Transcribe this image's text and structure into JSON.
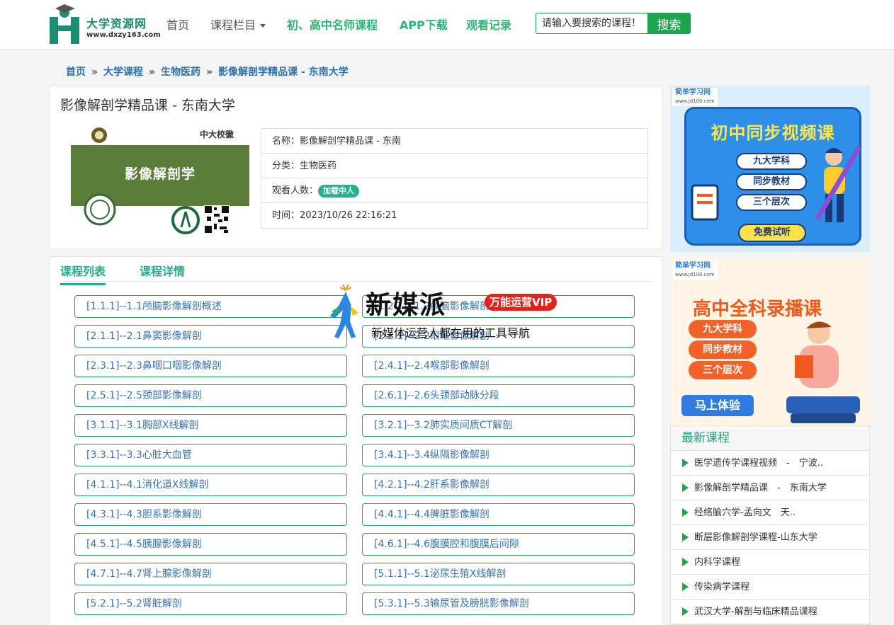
{
  "header": {
    "logo_title": "大学资源网",
    "logo_url": "www.dxzy163.com",
    "nav": {
      "home": "首页",
      "columns": "课程栏目",
      "teachers": "初、高中名师课程",
      "app": "APP下载",
      "history": "观看记录"
    },
    "search_placeholder": "请输入要搜索的课程！",
    "search_button": "搜索"
  },
  "breadcrumb": [
    "首页",
    "大学课程",
    "生物医药",
    "影像解剖学精品课 - 东南大学"
  ],
  "breadcrumb_sep": "»",
  "course": {
    "title": "影像解剖学精品课 - 东南大学",
    "cover_text": "影像解剖学",
    "cover_signature": "中大校徽",
    "name_row": "名称：影像解剖学精品课 - 东南",
    "category_row": "分类：生物医药",
    "viewers_label": "观看人数：",
    "viewers_badge": "加载中人",
    "time_row": "时间：2023/10/26 22:16:21"
  },
  "tabs": [
    "课程列表",
    "课程详情"
  ],
  "lessons": [
    "[1.1.1]--1.1颅脑影像解剖概述",
    "[1.2.1]--1.2颅脑影像解剖",
    "[2.1.1]--2.1鼻窦影像解剖",
    "[2.2.1]--2.2眼眶影像解剖",
    "[2.3.1]--2.3鼻咽口咽影像解剖",
    "[2.4.1]--2.4喉部影像解剖",
    "[2.5.1]--2.5颈部影像解剖",
    "[2.6.1]--2.6头颈部动脉分段",
    "[3.1.1]--3.1胸部X线解剖",
    "[3.2.1]--3.2肺实质间质CT解剖",
    "[3.3.1]--3.3心脏大血管",
    "[3.4.1]--3.4纵隔影像解剖",
    "[4.1.1]--4.1消化道X线解剖",
    "[4.2.1]--4.2肝系影像解剖",
    "[4.3.1]--4.3胆系影像解剖",
    "[4.4.1]--4.4脾脏影像解剖",
    "[4.5.1]--4.5胰腺影像解剖",
    "[4.6.1]--4.6腹膜腔和腹膜后间隙",
    "[4.7.1]--4.7肾上腺影像解剖",
    "[5.1.1]--5.1泌尿生殖X线解剖",
    "[5.2.1]--5.2肾脏解剖",
    "[5.3.1]--5.3输尿管及膀胱影像解剖"
  ],
  "ads": {
    "ad1": {
      "logo": "简单学习网",
      "logo_url": "www.jd100.com",
      "title": "初中同步视频课",
      "pills": [
        "九大学科",
        "同步教材",
        "三个层次"
      ],
      "cta": "免费试听"
    },
    "ad2": {
      "logo": "简单学习网",
      "logo_url": "www.jd100.com",
      "title": "高中全科录播课",
      "pills": [
        "九大学科",
        "同步教材",
        "三个层次"
      ],
      "cta": "马上体验"
    }
  },
  "latest": {
    "title": "最新课程",
    "items": [
      "医学遗传学课程视频　-　宁波..",
      "影像解剖学精品课　-　东南大学",
      "经络腧穴学-孟向文　天..",
      "断层影像解剖学课程-山东大学",
      "内科学课程",
      "传染病学课程",
      "武汉大学-解剖与临床精品课程"
    ]
  },
  "watermark": {
    "brand": "新媒派",
    "vip": "万能运营VIP",
    "subtitle": "新媒体运营人都在用的工具导航"
  }
}
